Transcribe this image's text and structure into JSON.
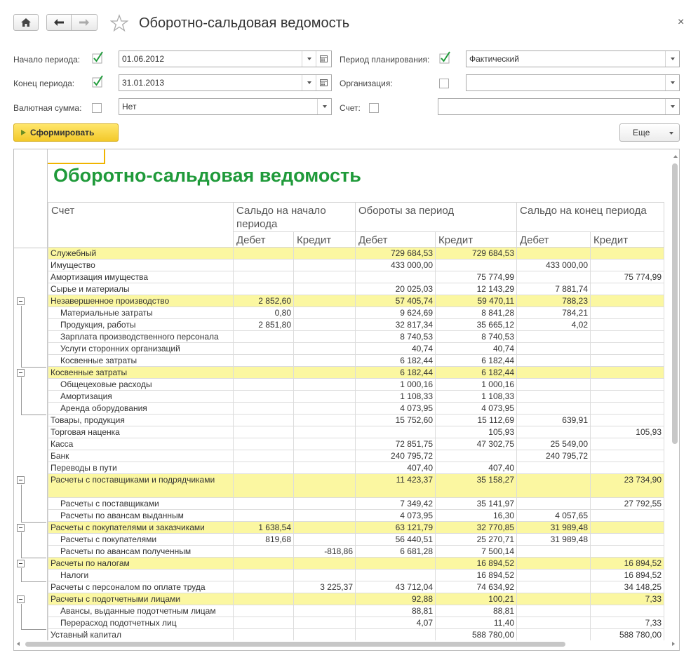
{
  "window": {
    "title": "Оборотно-сальдовая ведомость",
    "close": "×"
  },
  "form": {
    "start_label": "Начало периода:",
    "start_value": "01.06.2012",
    "end_label": "Конец периода:",
    "end_value": "31.01.2013",
    "currency_label": "Валютная сумма:",
    "currency_value": "Нет",
    "plan_label": "Период планирования:",
    "plan_value": "Фактический",
    "org_label": "Организация:",
    "org_value": "",
    "account_label": "Счет:",
    "account_value": ""
  },
  "buttons": {
    "generate": "Сформировать",
    "more": "Еще"
  },
  "report": {
    "title": "Оборотно-сальдовая ведомость",
    "headers": {
      "account": "Счет",
      "opening": "Сальдо на начало периода",
      "turnover": "Обороты за период",
      "closing": "Сальдо на конец периода",
      "debit": "Дебет",
      "credit": "Кредит"
    },
    "rows": [
      {
        "name": "Служебный",
        "od": "",
        "oc": "",
        "td": "729 684,53",
        "tc": "729 684,53",
        "cd": "",
        "cc": "",
        "hl": true,
        "indent": false
      },
      {
        "name": "Имущество",
        "od": "",
        "oc": "",
        "td": "433 000,00",
        "tc": "",
        "cd": "433 000,00",
        "cc": "",
        "hl": false,
        "indent": false
      },
      {
        "name": "Амортизация имущества",
        "od": "",
        "oc": "",
        "td": "",
        "tc": "75 774,99",
        "cd": "",
        "cc": "75 774,99",
        "hl": false,
        "indent": false
      },
      {
        "name": "Сырье и материалы",
        "od": "",
        "oc": "",
        "td": "20 025,03",
        "tc": "12 143,29",
        "cd": "7 881,74",
        "cc": "",
        "hl": false,
        "indent": false
      },
      {
        "name": "Незавершенное производство",
        "od": "2 852,60",
        "oc": "",
        "td": "57 405,74",
        "tc": "59 470,11",
        "cd": "788,23",
        "cc": "",
        "hl": true,
        "indent": false
      },
      {
        "name": "Материальные затраты",
        "od": "0,80",
        "oc": "",
        "td": "9 624,69",
        "tc": "8 841,28",
        "cd": "784,21",
        "cc": "",
        "hl": false,
        "indent": true
      },
      {
        "name": "Продукция, работы",
        "od": "2 851,80",
        "oc": "",
        "td": "32 817,34",
        "tc": "35 665,12",
        "cd": "4,02",
        "cc": "",
        "hl": false,
        "indent": true
      },
      {
        "name": "Зарплата производственного персонала",
        "od": "",
        "oc": "",
        "td": "8 740,53",
        "tc": "8 740,53",
        "cd": "",
        "cc": "",
        "hl": false,
        "indent": true
      },
      {
        "name": "Услуги сторонних организаций",
        "od": "",
        "oc": "",
        "td": "40,74",
        "tc": "40,74",
        "cd": "",
        "cc": "",
        "hl": false,
        "indent": true
      },
      {
        "name": "Косвенные затраты",
        "od": "",
        "oc": "",
        "td": "6 182,44",
        "tc": "6 182,44",
        "cd": "",
        "cc": "",
        "hl": false,
        "indent": true
      },
      {
        "name": "Косвенные затраты",
        "od": "",
        "oc": "",
        "td": "6 182,44",
        "tc": "6 182,44",
        "cd": "",
        "cc": "",
        "hl": true,
        "indent": false
      },
      {
        "name": "Общецеховые расходы",
        "od": "",
        "oc": "",
        "td": "1 000,16",
        "tc": "1 000,16",
        "cd": "",
        "cc": "",
        "hl": false,
        "indent": true
      },
      {
        "name": "Амортизация",
        "od": "",
        "oc": "",
        "td": "1 108,33",
        "tc": "1 108,33",
        "cd": "",
        "cc": "",
        "hl": false,
        "indent": true
      },
      {
        "name": "Аренда оборудования",
        "od": "",
        "oc": "",
        "td": "4 073,95",
        "tc": "4 073,95",
        "cd": "",
        "cc": "",
        "hl": false,
        "indent": true
      },
      {
        "name": "Товары, продукция",
        "od": "",
        "oc": "",
        "td": "15 752,60",
        "tc": "15 112,69",
        "cd": "639,91",
        "cc": "",
        "hl": false,
        "indent": false
      },
      {
        "name": "Торговая наценка",
        "od": "",
        "oc": "",
        "td": "",
        "tc": "105,93",
        "cd": "",
        "cc": "105,93",
        "hl": false,
        "indent": false
      },
      {
        "name": "Касса",
        "od": "",
        "oc": "",
        "td": "72 851,75",
        "tc": "47 302,75",
        "cd": "25 549,00",
        "cc": "",
        "hl": false,
        "indent": false
      },
      {
        "name": "Банк",
        "od": "",
        "oc": "",
        "td": "240 795,72",
        "tc": "",
        "cd": "240 795,72",
        "cc": "",
        "hl": false,
        "indent": false
      },
      {
        "name": "Переводы в пути",
        "od": "",
        "oc": "",
        "td": "407,40",
        "tc": "407,40",
        "cd": "",
        "cc": "",
        "hl": false,
        "indent": false
      },
      {
        "name": "Расчеты с поставщиками и подрядчиками",
        "od": "",
        "oc": "",
        "td": "11 423,37",
        "tc": "35 158,27",
        "cd": "",
        "cc": "23 734,90",
        "hl": true,
        "indent": false,
        "tall": true
      },
      {
        "name": "Расчеты с поставщиками",
        "od": "",
        "oc": "",
        "td": "7 349,42",
        "tc": "35 141,97",
        "cd": "",
        "cc": "27 792,55",
        "hl": false,
        "indent": true
      },
      {
        "name": "Расчеты по авансам выданным",
        "od": "",
        "oc": "",
        "td": "4 073,95",
        "tc": "16,30",
        "cd": "4 057,65",
        "cc": "",
        "hl": false,
        "indent": true
      },
      {
        "name": "Расчеты с покупателями и заказчиками",
        "od": "1 638,54",
        "oc": "",
        "td": "63 121,79",
        "tc": "32 770,85",
        "cd": "31 989,48",
        "cc": "",
        "hl": true,
        "indent": false
      },
      {
        "name": "Расчеты с покупателями",
        "od": "819,68",
        "oc": "",
        "td": "56 440,51",
        "tc": "25 270,71",
        "cd": "31 989,48",
        "cc": "",
        "hl": false,
        "indent": true
      },
      {
        "name": "Расчеты по авансам полученным",
        "od": "",
        "oc": "-818,86",
        "td": "6 681,28",
        "tc": "7 500,14",
        "cd": "",
        "cc": "",
        "hl": false,
        "indent": true
      },
      {
        "name": "Расчеты по налогам",
        "od": "",
        "oc": "",
        "td": "",
        "tc": "16 894,52",
        "cd": "",
        "cc": "16 894,52",
        "hl": true,
        "indent": false
      },
      {
        "name": "Налоги",
        "od": "",
        "oc": "",
        "td": "",
        "tc": "16 894,52",
        "cd": "",
        "cc": "16 894,52",
        "hl": false,
        "indent": true
      },
      {
        "name": "Расчеты с персоналом по оплате труда",
        "od": "",
        "oc": "3 225,37",
        "td": "43 712,04",
        "tc": "74 634,92",
        "cd": "",
        "cc": "34 148,25",
        "hl": false,
        "indent": false
      },
      {
        "name": "Расчеты с подотчетными лицами",
        "od": "",
        "oc": "",
        "td": "92,88",
        "tc": "100,21",
        "cd": "",
        "cc": "7,33",
        "hl": true,
        "indent": false
      },
      {
        "name": "Авансы, выданные подотчетным лицам",
        "od": "",
        "oc": "",
        "td": "88,81",
        "tc": "88,81",
        "cd": "",
        "cc": "",
        "hl": false,
        "indent": true
      },
      {
        "name": "Перерасход подотчетных лиц",
        "od": "",
        "oc": "",
        "td": "4,07",
        "tc": "11,40",
        "cd": "",
        "cc": "7,33",
        "hl": false,
        "indent": true
      },
      {
        "name": "Уставный капитал",
        "od": "",
        "oc": "",
        "td": "",
        "tc": "588 780,00",
        "cd": "",
        "cc": "588 780,00",
        "hl": false,
        "indent": false
      }
    ]
  }
}
